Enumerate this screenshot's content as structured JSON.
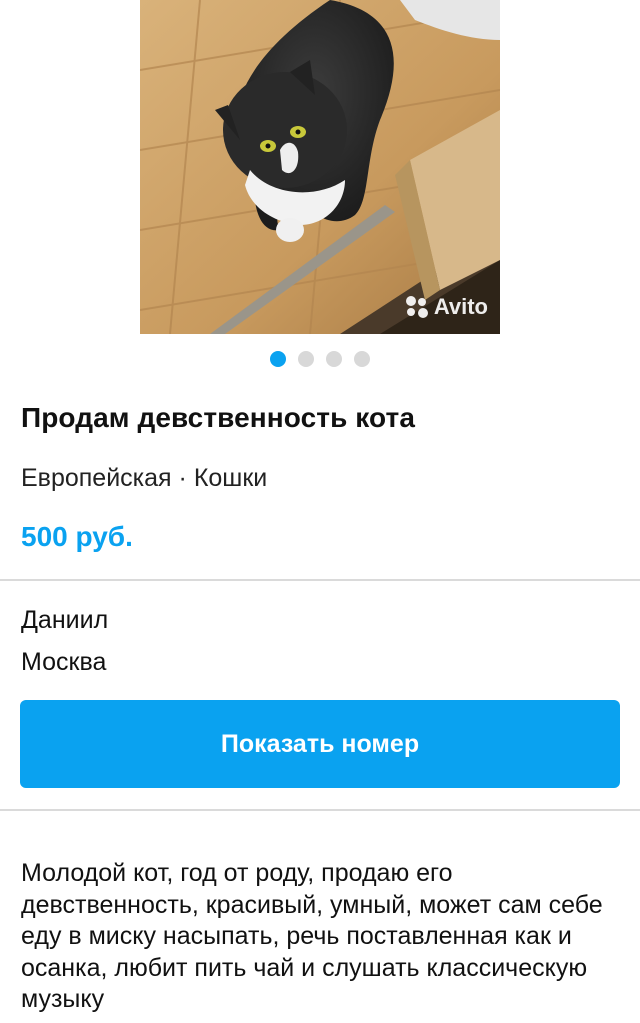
{
  "listing": {
    "photo": {
      "alt": "",
      "watermark": "Avito",
      "count": 4,
      "active_index": 0
    },
    "title": "Продам девственность кота",
    "category": "Европейская · Кошки",
    "price": "500 руб.",
    "seller": {
      "name": "Даниил",
      "city": "Москва"
    },
    "show_phone_label": "Показать номер",
    "description": "Молодой кот, год от роду, продаю его девственность, красивый, умный, может сам себе еду в миску насыпать, речь поставленная как и осанка, любит пить чай и слушать классическую музыку"
  },
  "colors": {
    "accent": "#0aa2f0",
    "divider": "#dadada",
    "dot_inactive": "#d8d8d8"
  }
}
